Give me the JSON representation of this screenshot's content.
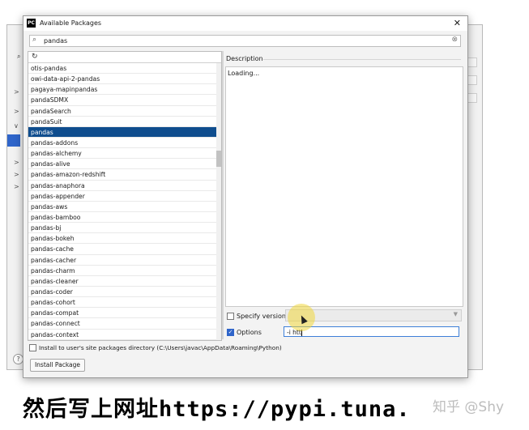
{
  "dialog": {
    "title": "Available Packages",
    "app_icon_label": "PC",
    "close_symbol": "✕",
    "search_value": "pandas",
    "reload_symbol": "↻",
    "packages": [
      "otis-pandas",
      "owi-data-api-2-pandas",
      "pagaya-mapinpandas",
      "pandaSDMX",
      "pandaSearch",
      "pandaSuit",
      "pandas",
      "pandas-addons",
      "pandas-alchemy",
      "pandas-alive",
      "pandas-amazon-redshift",
      "pandas-anaphora",
      "pandas-appender",
      "pandas-aws",
      "pandas-bamboo",
      "pandas-bj",
      "pandas-bokeh",
      "pandas-cache",
      "pandas-cacher",
      "pandas-charm",
      "pandas-cleaner",
      "pandas-coder",
      "pandas-cohort",
      "pandas-compat",
      "pandas-connect",
      "pandas-context"
    ],
    "selected_package": "pandas",
    "description_label": "Description",
    "description_text": "Loading...",
    "specify_version_label": "Specify version",
    "specify_version_checked": false,
    "options_label": "Options",
    "options_checked": true,
    "options_value": "-i htt",
    "install_user_label": "Install to user's site packages directory (C:\\Users\\javac\\AppData\\Roaming\\Python)",
    "install_user_checked": false,
    "install_button": "Install Package"
  },
  "background": {
    "help_symbol": "?",
    "arrows": [
      ">",
      ">",
      "∨",
      ">",
      ">",
      ">"
    ]
  },
  "caption": "然后写上网址https://pypi.tuna.",
  "watermark": "知乎 @Shy",
  "colors": {
    "selection": "#0f4d8e",
    "accent": "#2f65ca",
    "highlight": "#f0d73c"
  }
}
